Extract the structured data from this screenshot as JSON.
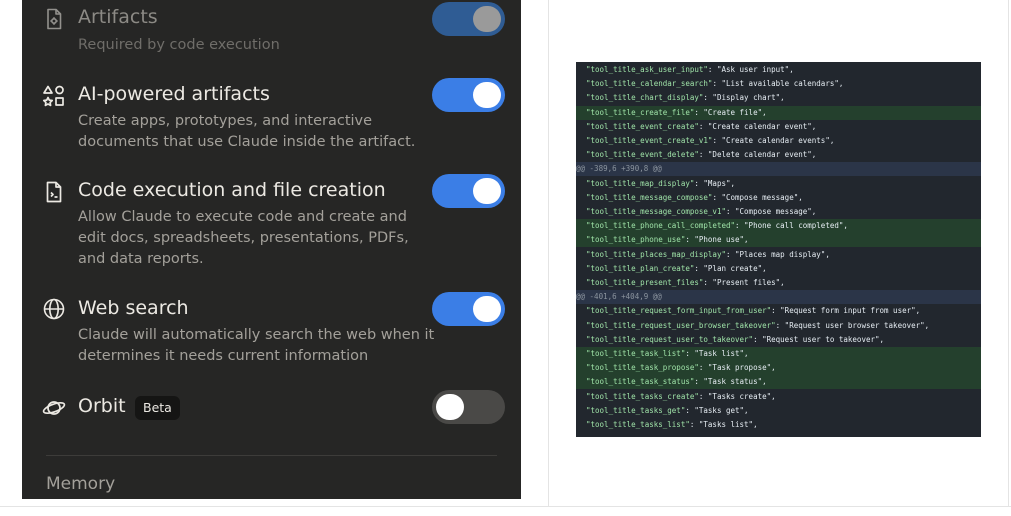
{
  "settings": {
    "rows": [
      {
        "title": "Artifacts",
        "description": "Required by code execution",
        "icon": "file-gear-icon",
        "toggle": "on-disabled"
      },
      {
        "title": "AI-powered artifacts",
        "description": "Create apps, prototypes, and interactive documents that use Claude inside the artifact.",
        "icon": "shapes-icon",
        "toggle": "on"
      },
      {
        "title": "Code execution and file creation",
        "description": "Allow Claude to execute code and create and edit docs, spreadsheets, presentations, PDFs, and data reports.",
        "icon": "document-icon",
        "toggle": "on"
      },
      {
        "title": "Web search",
        "description": "Claude will automatically search the web when it determines it needs current information",
        "icon": "globe-icon",
        "toggle": "on"
      },
      {
        "title": "Orbit",
        "badge": "Beta",
        "icon": "planet-icon",
        "toggle": "off"
      }
    ],
    "memory_label": "Memory"
  },
  "code_diff": {
    "lines": [
      {
        "type": "context",
        "key": "\"tool_title_ask_user_input\"",
        "value": ": \"Ask user input\","
      },
      {
        "type": "context",
        "key": "\"tool_title_calendar_search\"",
        "value": ": \"List available calendars\","
      },
      {
        "type": "context",
        "key": "\"tool_title_chart_display\"",
        "value": ": \"Display chart\","
      },
      {
        "type": "added",
        "key": "\"tool_title_create_file\"",
        "value": ": \"Create file\","
      },
      {
        "type": "context",
        "key": "\"tool_title_event_create\"",
        "value": ": \"Create calendar event\","
      },
      {
        "type": "context",
        "key": "\"tool_title_event_create_v1\"",
        "value": ": \"Create calendar events\","
      },
      {
        "type": "context",
        "key": "\"tool_title_event_delete\"",
        "value": ": \"Delete calendar event\","
      },
      {
        "type": "hunk",
        "text": "@@ -389,6 +390,8 @@"
      },
      {
        "type": "context",
        "key": "\"tool_title_map_display\"",
        "value": ": \"Maps\","
      },
      {
        "type": "context",
        "key": "\"tool_title_message_compose\"",
        "value": ": \"Compose message\","
      },
      {
        "type": "context",
        "key": "\"tool_title_message_compose_v1\"",
        "value": ": \"Compose message\","
      },
      {
        "type": "added",
        "key": "\"tool_title_phone_call_completed\"",
        "value": ": \"Phone call completed\","
      },
      {
        "type": "added",
        "key": "\"tool_title_phone_use\"",
        "value": ": \"Phone use\","
      },
      {
        "type": "context",
        "key": "\"tool_title_places_map_display\"",
        "value": ": \"Places map display\","
      },
      {
        "type": "context",
        "key": "\"tool_title_plan_create\"",
        "value": ": \"Plan create\","
      },
      {
        "type": "context",
        "key": "\"tool_title_present_files\"",
        "value": ": \"Present files\","
      },
      {
        "type": "hunk",
        "text": "@@ -401,6 +404,9 @@"
      },
      {
        "type": "context",
        "key": "\"tool_title_request_form_input_from_user\"",
        "value": ": \"Request form input from user\","
      },
      {
        "type": "context",
        "key": "\"tool_title_request_user_browser_takeover\"",
        "value": ": \"Request user browser takeover\","
      },
      {
        "type": "context",
        "key": "\"tool_title_request_user_to_takeover\"",
        "value": ": \"Request user to takeover\","
      },
      {
        "type": "added",
        "key": "\"tool_title_task_list\"",
        "value": ": \"Task list\","
      },
      {
        "type": "added",
        "key": "\"tool_title_task_propose\"",
        "value": ": \"Task propose\","
      },
      {
        "type": "added",
        "key": "\"tool_title_task_status\"",
        "value": ": \"Task status\","
      },
      {
        "type": "context",
        "key": "\"tool_title_tasks_create\"",
        "value": ": \"Tasks create\","
      },
      {
        "type": "context",
        "key": "\"tool_title_tasks_get\"",
        "value": ": \"Tasks get\","
      },
      {
        "type": "context",
        "key": "\"tool_title_tasks_list\"",
        "value": ": \"Tasks list\","
      }
    ]
  },
  "colors": {
    "panel_bg": "#262625",
    "toggle_on": "#3b7ee6",
    "code_bg": "#22272e",
    "diff_added_bg": "#24402d",
    "code_key": "#9fe3a8"
  }
}
